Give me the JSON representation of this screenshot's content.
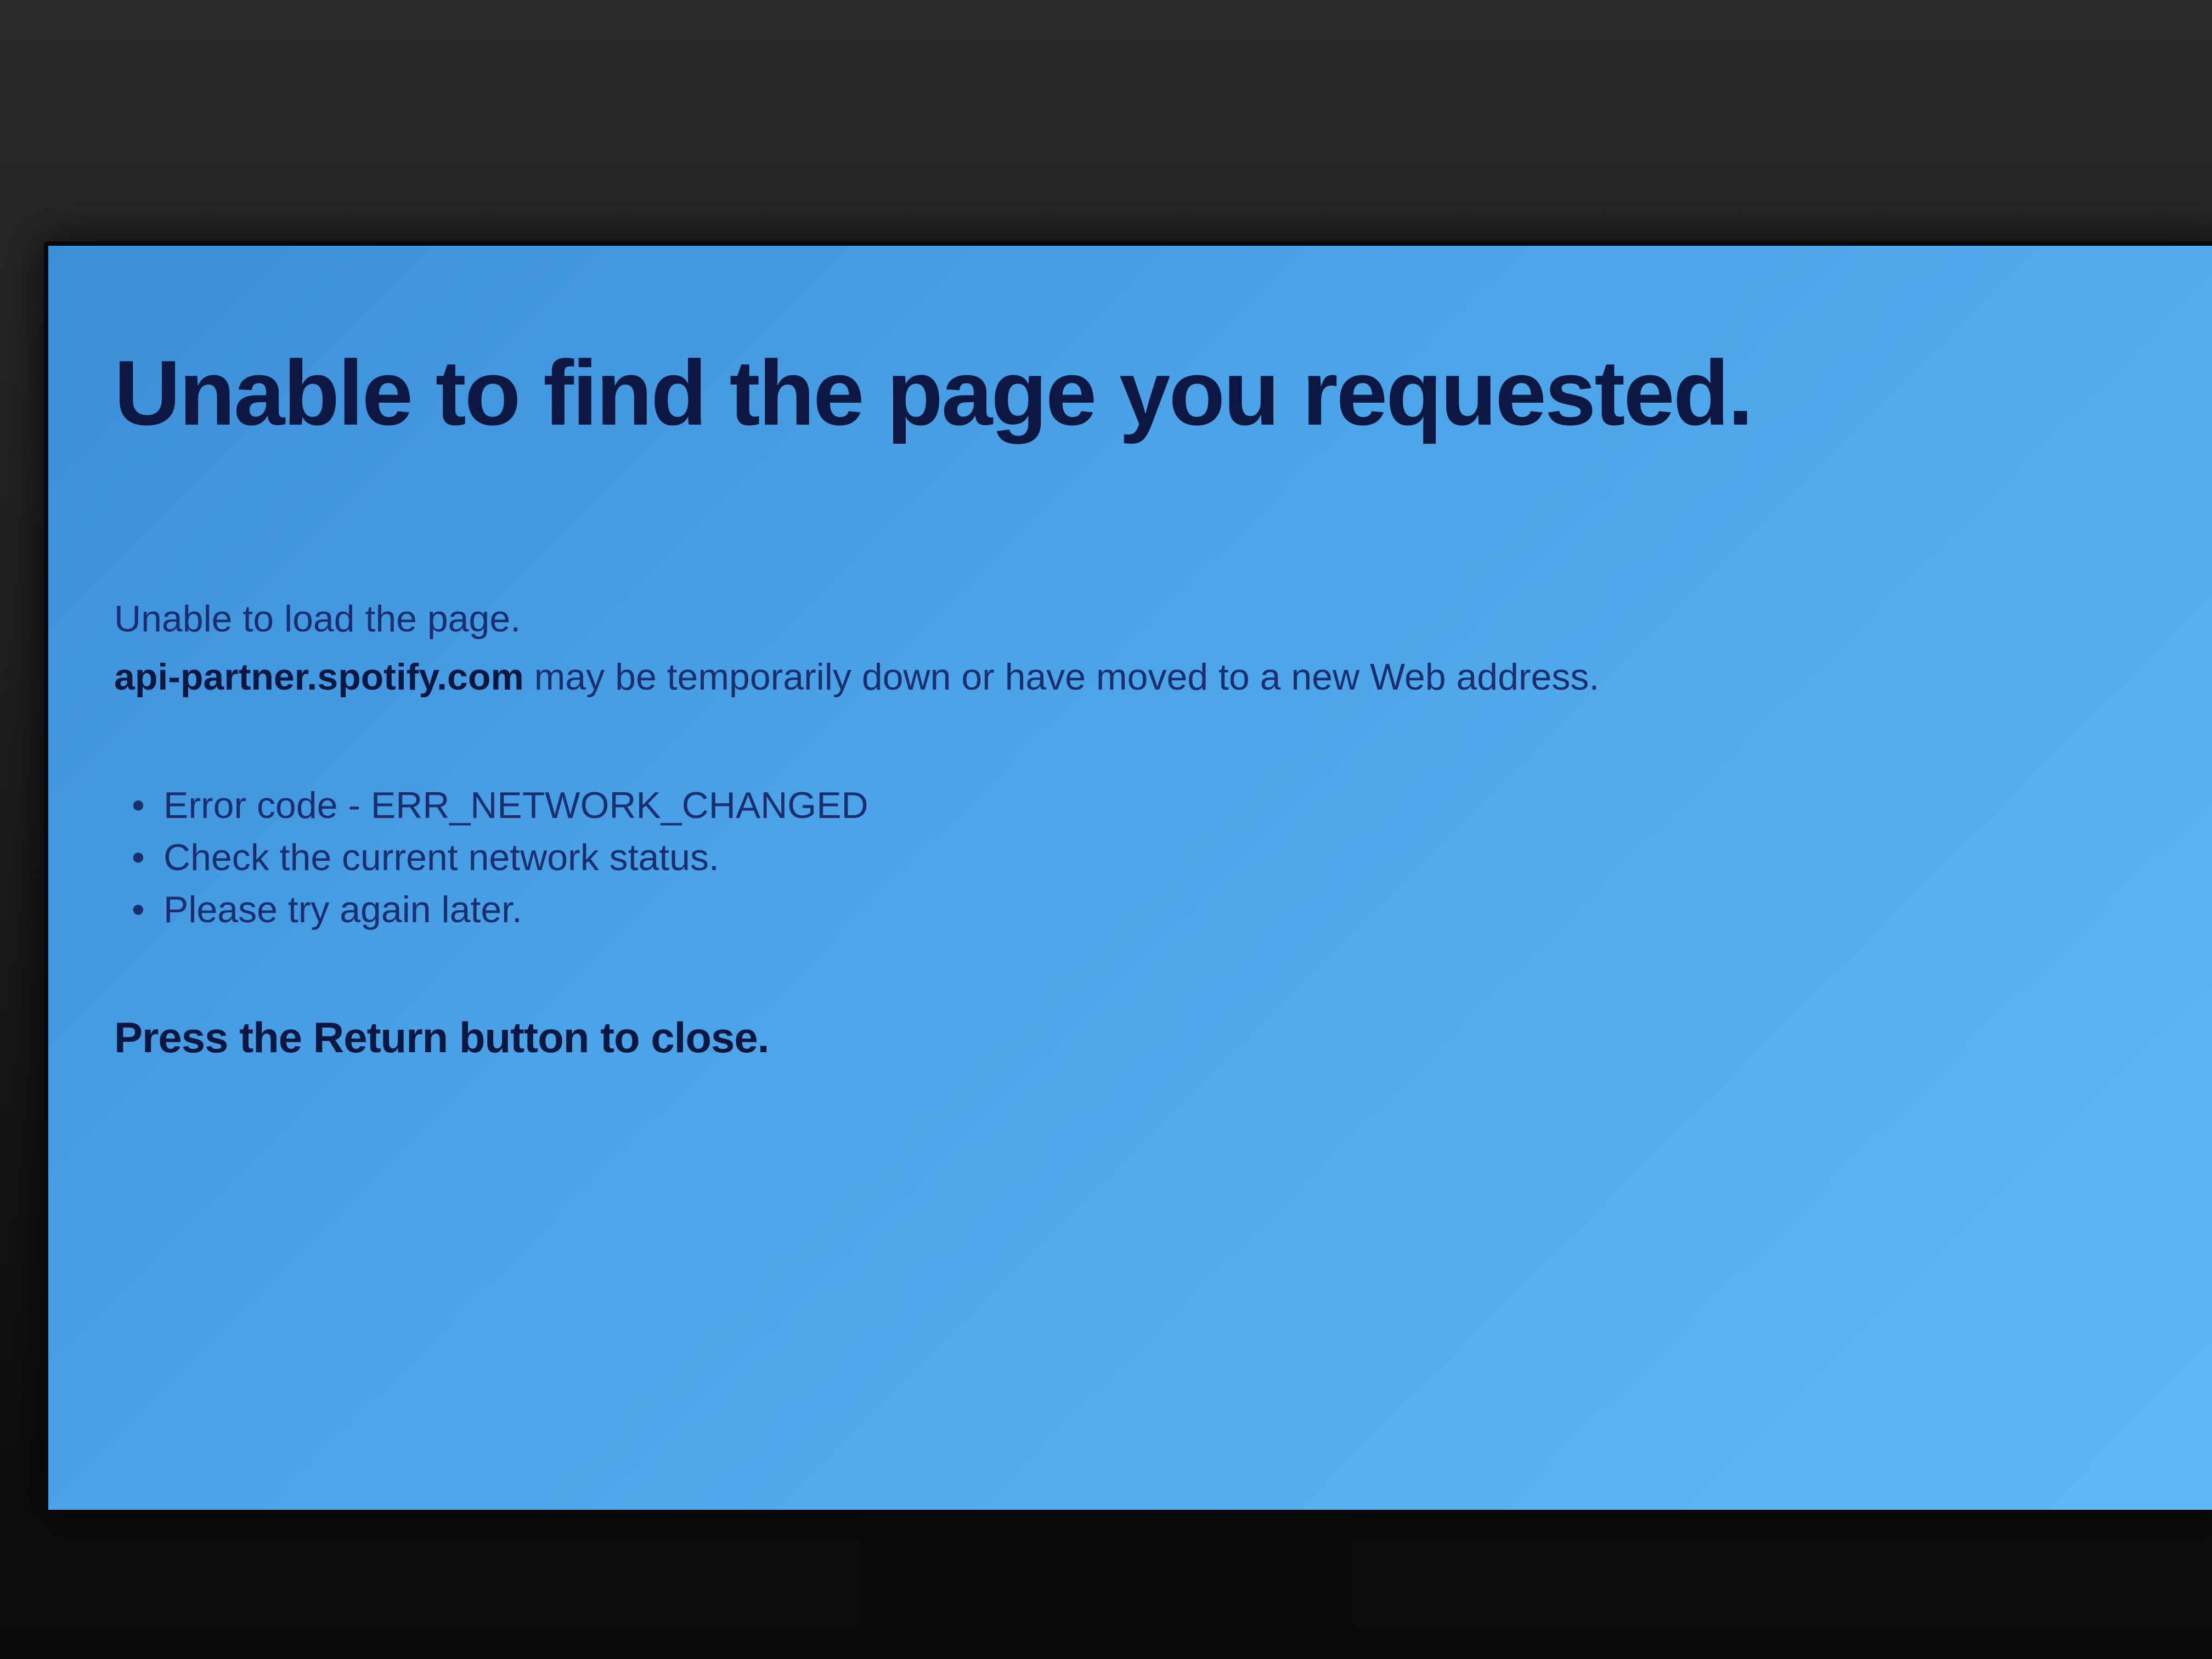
{
  "error": {
    "title": "Unable to find the page you requested.",
    "subtitle": "Unable to load the page.",
    "domain": "api-partner.spotify.com",
    "detail_suffix": " may be temporarily down or have moved to a new Web address.",
    "bullets": [
      "Error code - ERR_NETWORK_CHANGED",
      "Check the current network status.",
      "Please try again later."
    ],
    "close_instruction": "Press the Return button to close."
  }
}
